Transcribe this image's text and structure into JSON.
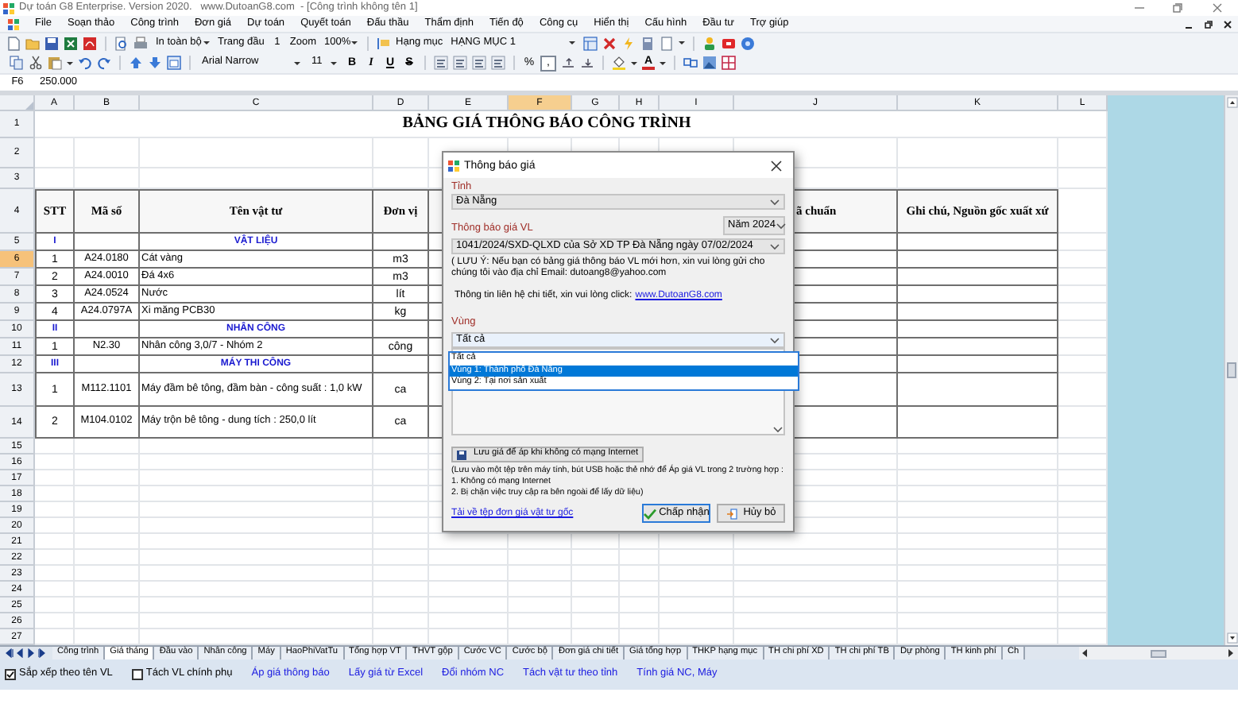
{
  "window": {
    "title": "Dự toán G8 Enterprise. Version 2020.   www.DutoanG8.com  - [Công trình không tên 1]"
  },
  "menu": [
    "File",
    "Soạn thảo",
    "Công trình",
    "Đơn giá",
    "Dự toán",
    "Quyết toán",
    "Đấu thầu",
    "Thẩm định",
    "Tiến độ",
    "Công cụ",
    "Hiển thị",
    "Cấu hình",
    "Đầu tư",
    "Trợ giúp"
  ],
  "toolbar": {
    "print_mode": "In toàn bộ",
    "page_label": "Trang đầu",
    "page": "1",
    "zoom_label": "Zoom",
    "zoom": "100%",
    "category_label": "Hạng mục",
    "category": "HẠNG MỤC 1",
    "font": "Arial Narrow",
    "font_size": "11",
    "format_buttons": [
      "B",
      "I",
      "U",
      "S"
    ],
    "percent": "%",
    "comma": ",",
    "font_color": "A"
  },
  "formula_bar": {
    "cell": "F6",
    "value": "250.000"
  },
  "sheet": {
    "columns": [
      {
        "label": "A",
        "selected": false
      },
      {
        "label": "B",
        "selected": false
      },
      {
        "label": "C",
        "selected": false
      },
      {
        "label": "D",
        "selected": false
      },
      {
        "label": "E",
        "selected": false
      },
      {
        "label": "F",
        "selected": true
      },
      {
        "label": "G",
        "selected": false
      },
      {
        "label": "H",
        "selected": false
      },
      {
        "label": "I",
        "selected": false
      },
      {
        "label": "J",
        "selected": false
      },
      {
        "label": "K",
        "selected": false
      },
      {
        "label": "L",
        "selected": false
      }
    ],
    "title": "BẢNG GIÁ THÔNG BÁO CÔNG TRÌNH",
    "header": {
      "stt": "STT",
      "code": "Mã số",
      "name": "Tên vật tư",
      "unit": "Đơn vị",
      "column_j": "ã chuẩn",
      "note": "Ghi chú, Nguồn gốc xuất xứ"
    },
    "row_numbers": [
      {
        "label": "1",
        "selected": false
      },
      {
        "label": "2",
        "selected": false
      },
      {
        "label": "3",
        "selected": false
      },
      {
        "label": "4",
        "selected": false
      },
      {
        "label": "5",
        "selected": false
      },
      {
        "label": "6",
        "selected": true
      },
      {
        "label": "7",
        "selected": false
      },
      {
        "label": "8",
        "selected": false
      },
      {
        "label": "9",
        "selected": false
      },
      {
        "label": "10",
        "selected": false
      },
      {
        "label": "11",
        "selected": false
      },
      {
        "label": "12",
        "selected": false
      },
      {
        "label": "13",
        "selected": false
      },
      {
        "label": "14",
        "selected": false
      },
      {
        "label": "15",
        "selected": false
      },
      {
        "label": "16",
        "selected": false
      },
      {
        "label": "17",
        "selected": false
      },
      {
        "label": "18",
        "selected": false
      },
      {
        "label": "19",
        "selected": false
      },
      {
        "label": "20",
        "selected": false
      },
      {
        "label": "21",
        "selected": false
      },
      {
        "label": "22",
        "selected": false
      },
      {
        "label": "23",
        "selected": false
      },
      {
        "label": "24",
        "selected": false
      },
      {
        "label": "25",
        "selected": false
      },
      {
        "label": "26",
        "selected": false
      },
      {
        "label": "27",
        "selected": false
      }
    ],
    "rows": [
      {
        "kind": "section",
        "stt": "I",
        "name": "VẬT LIỆU"
      },
      {
        "kind": "item",
        "stt": "1",
        "code": "A24.0180",
        "name": "Cát vàng",
        "unit": "m3"
      },
      {
        "kind": "item",
        "stt": "2",
        "code": "A24.0010",
        "name": "Đá 4x6",
        "unit": "m3"
      },
      {
        "kind": "item",
        "stt": "3",
        "code": "A24.0524",
        "name": "Nước",
        "unit": "lít"
      },
      {
        "kind": "item",
        "stt": "4",
        "code": "A24.0797A",
        "name": "Xi măng PCB30",
        "unit": "kg"
      },
      {
        "kind": "section",
        "stt": "II",
        "name": "NHÂN CÔNG"
      },
      {
        "kind": "item",
        "stt": "1",
        "code": "N2.30",
        "name": "Nhân công 3,0/7 - Nhóm 2",
        "unit": "công"
      },
      {
        "kind": "section",
        "stt": "III",
        "name": "MÁY THI CÔNG"
      },
      {
        "kind": "item",
        "stt": "1",
        "code": "M112.1101",
        "name": "Máy đầm bê tông, đầm bàn - công suất : 1,0 kW",
        "unit": "ca"
      },
      {
        "kind": "item",
        "stt": "2",
        "code": "M104.0102",
        "name": "Máy trộn bê tông - dung tích : 250,0 lít",
        "unit": "ca"
      }
    ],
    "tabs": [
      {
        "label": "Công trình",
        "selected": false
      },
      {
        "label": "Giá tháng",
        "selected": true
      },
      {
        "label": "Đầu vào",
        "selected": false
      },
      {
        "label": "Nhân công",
        "selected": false
      },
      {
        "label": "Máy",
        "selected": false
      },
      {
        "label": "HaoPhiVatTu",
        "selected": false
      },
      {
        "label": "Tổng hợp VT",
        "selected": false
      },
      {
        "label": "THVT gộp",
        "selected": false
      },
      {
        "label": "Cước VC",
        "selected": false
      },
      {
        "label": "Cước bộ",
        "selected": false
      },
      {
        "label": "Đơn giá chi tiết",
        "selected": false
      },
      {
        "label": "Giá tổng hợp",
        "selected": false
      },
      {
        "label": "THKP hạng mục",
        "selected": false
      },
      {
        "label": "TH chi phí XD",
        "selected": false
      },
      {
        "label": "TH chi phí TB",
        "selected": false
      },
      {
        "label": "Dự phòng",
        "selected": false
      },
      {
        "label": "TH kinh phí",
        "selected": false
      },
      {
        "label": "Ch",
        "selected": false
      }
    ]
  },
  "dialog": {
    "title": "Thông báo giá",
    "province_label": "Tỉnh",
    "province": "Đà Nẵng",
    "notice_label": "Thông báo giá VL",
    "year": "Năm 2024",
    "notice": "1041/2024/SXD-QLXD của Sở XD TP Đà Nẵng ngày 07/02/2024",
    "note": "( LƯU Ý: Nếu bạn có bảng giá thông báo VL mới hơn, xin vui lòng gửi cho chúng tôi vào địa chỉ Email:  dutoang8@yahoo.com",
    "contact": "Thông tin liên hệ chi tiết, xin vui lòng click:",
    "contact_link": "www.DutoanG8.com",
    "region_label": "Vùng",
    "region": "Tất cả",
    "region_options": [
      {
        "label": "Tất cả",
        "selected": false
      },
      {
        "label": "Vùng 1: Thành phố Đà Nẵng",
        "selected": true
      },
      {
        "label": "Vùng 2: Tại nơi sản xuất",
        "selected": false
      }
    ],
    "save_button": "Lưu giá để áp khi không có mạng Internet",
    "save_notes": [
      "(Lưu vào một tệp trên máy tính, bút USB hoặc thẻ nhớ để Áp giá VL trong 2 trường hợp :",
      "1. Không có mạng Internet",
      "2. Bị chặn việc truy cập ra bên ngoài để lấy dữ liệu)"
    ],
    "reset_link": "Tải về tệp đơn giá vật tư gốc",
    "ok": "Chấp nhận",
    "cancel": "Hủy bỏ"
  },
  "bottom_bar": {
    "options": [
      {
        "label": "Sắp xếp theo tên VL",
        "checked": true
      },
      {
        "label": "Tách VL chính phụ",
        "checked": false
      }
    ],
    "actions": [
      "Áp giá thông báo",
      "Lấy giá từ Excel",
      "Đổi nhóm NC",
      "Tách vật tư theo tỉnh",
      "Tính giá NC, Máy"
    ]
  }
}
